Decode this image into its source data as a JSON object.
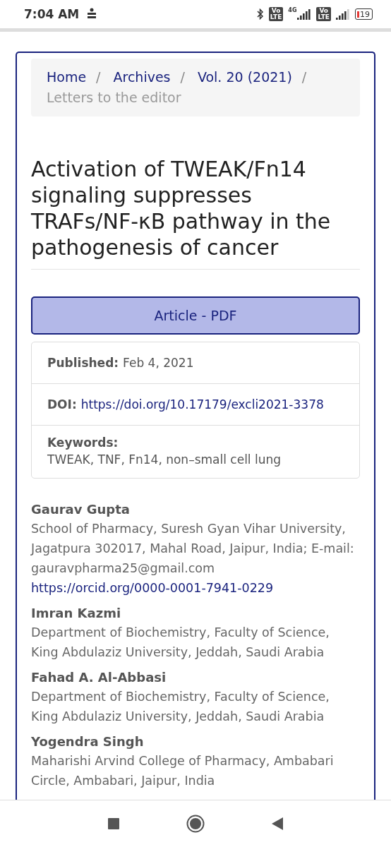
{
  "status_bar": {
    "time": "7:04 AM",
    "network": "4G",
    "sims": [
      {
        "badge_top": "Vo",
        "badge_bottom": "LTE"
      },
      {
        "badge_top": "Vo",
        "badge_bottom": "LTE"
      }
    ],
    "battery": "19"
  },
  "breadcrumb": [
    {
      "label": "Home",
      "current": false
    },
    {
      "label": "Archives",
      "current": false
    },
    {
      "label": "Vol. 20 (2021)",
      "current": false
    },
    {
      "label": "Letters to the editor",
      "current": true
    }
  ],
  "breadcrumb_separator": "/",
  "title": "Activation of TWEAK/Fn14 signaling suppresses TRAFs/NF-κB pathway in the pathogenesis of cancer",
  "pdf_button": "Article - PDF",
  "details": [
    {
      "kind": "inline",
      "label": "Published:",
      "value": "Feb 4, 2021",
      "link": false
    },
    {
      "kind": "inline",
      "label": "DOI:",
      "value": "https://doi.org/10.17179/excli2021-3378",
      "link": true
    },
    {
      "kind": "block",
      "label": "Keywords:",
      "value": "TWEAK, TNF, Fn14, non–small cell lung",
      "link": false
    }
  ],
  "authors": [
    {
      "name": "Gaurav Gupta",
      "affiliation": "School of Pharmacy, Suresh Gyan Vihar University, Jagatpura 302017, Mahal Road, Jaipur, India; E-mail: gauravpharma25@gmail.com",
      "orcid": "https://orcid.org/0000-0001-7941-0229"
    },
    {
      "name": "Imran Kazmi",
      "affiliation": "Department of Biochemistry, Faculty of Science, King Abdulaziz University, Jeddah, Saudi Arabia"
    },
    {
      "name": "Fahad A. Al-Abbasi",
      "affiliation": "Department of Biochemistry, Faculty of Science, King Abdulaziz University, Jeddah, Saudi Arabia"
    },
    {
      "name": "Yogendra Singh",
      "affiliation": "Maharishi Arvind College of Pharmacy, Ambabari Circle, Ambabari, Jaipur, India"
    }
  ]
}
